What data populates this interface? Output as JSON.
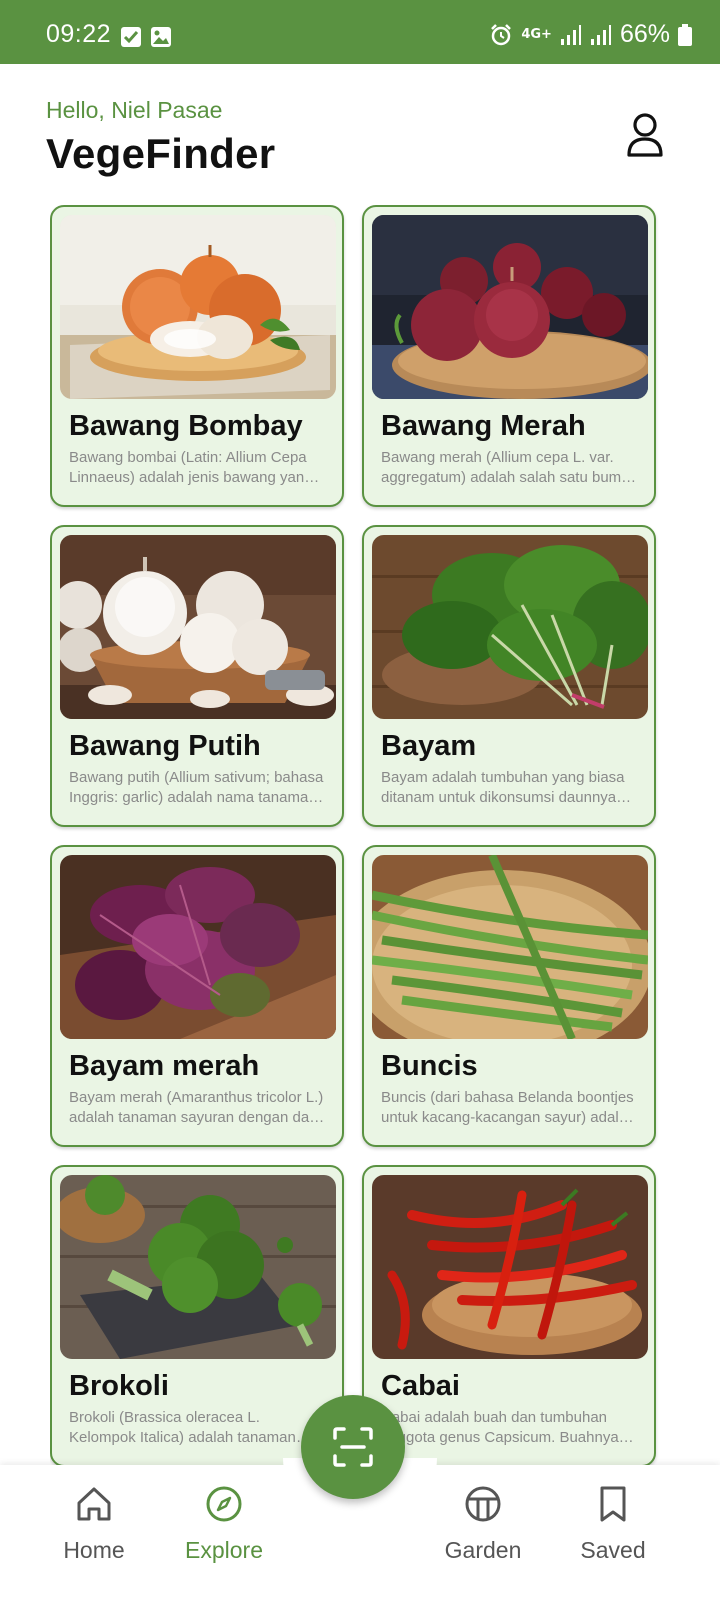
{
  "status_bar": {
    "time": "09:22",
    "network": "4G+",
    "battery": "66%"
  },
  "header": {
    "greeting": "Hello, Niel Pasae",
    "title": "VegeFinder",
    "profile_icon": "person-icon"
  },
  "vegetables": [
    {
      "name": "Bawang Bombay",
      "description": "Bawang bombai (Latin: Allium Cepa Linnaeus) adalah jenis bawang yang banyak dijumpai"
    },
    {
      "name": "Bawang Merah",
      "description": "Bawang merah (Allium cepa L. var. aggregatum) adalah salah satu bumbu masak utama"
    },
    {
      "name": "Bawang Putih",
      "description": "Bawang putih (Allium sativum; bahasa Inggris: garlic) adalah nama tanaman dari genus"
    },
    {
      "name": "Bayam",
      "description": "Bayam adalah tumbuhan yang biasa ditanam untuk dikonsumsi daunnya sebagai sayuran"
    },
    {
      "name": "Bayam merah",
      "description": "Bayam merah (Amaranthus tricolor L.) adalah tanaman sayuran dengan daun berwarna merah"
    },
    {
      "name": "Buncis",
      "description": "Buncis (dari bahasa Belanda boontjes untuk kacang-kacangan sayur) adalah sejenis polong"
    },
    {
      "name": "Brokoli",
      "description": "Brokoli (Brassica oleracea L. Kelompok Italica) adalah tanaman sayuran dari suku kubis"
    },
    {
      "name": "Cabai",
      "description": "Cabai adalah buah dan tumbuhan anggota genus Capsicum. Buahnya dapat digolongkan"
    }
  ],
  "bottom_nav": {
    "items": [
      {
        "label": "Home",
        "icon": "home-icon",
        "active": false
      },
      {
        "label": "Explore",
        "icon": "compass-icon",
        "active": true
      },
      {
        "label": "Garden",
        "icon": "garden-icon",
        "active": false
      },
      {
        "label": "Saved",
        "icon": "bookmark-icon",
        "active": false
      }
    ],
    "scan_icon": "scan-icon"
  },
  "colors": {
    "primary": "#5a9241",
    "card_background": "#eaf5e4",
    "description_text": "#8a8a8a"
  }
}
